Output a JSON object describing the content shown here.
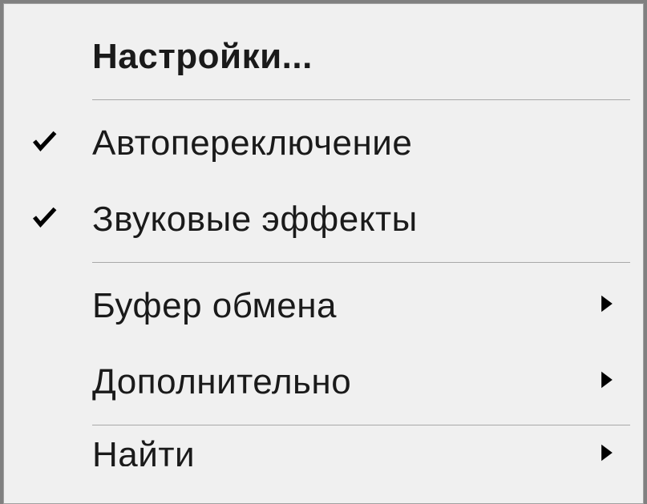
{
  "menu": {
    "items": [
      {
        "label": "Настройки...",
        "bold": true,
        "checked": false,
        "submenu": false
      },
      {
        "label": "Автопереключение",
        "bold": false,
        "checked": true,
        "submenu": false
      },
      {
        "label": "Звуковые эффекты",
        "bold": false,
        "checked": true,
        "submenu": false
      },
      {
        "label": "Буфер обмена",
        "bold": false,
        "checked": false,
        "submenu": true
      },
      {
        "label": "Дополнительно",
        "bold": false,
        "checked": false,
        "submenu": true
      },
      {
        "label": "Найти",
        "bold": false,
        "checked": false,
        "submenu": true
      }
    ]
  }
}
